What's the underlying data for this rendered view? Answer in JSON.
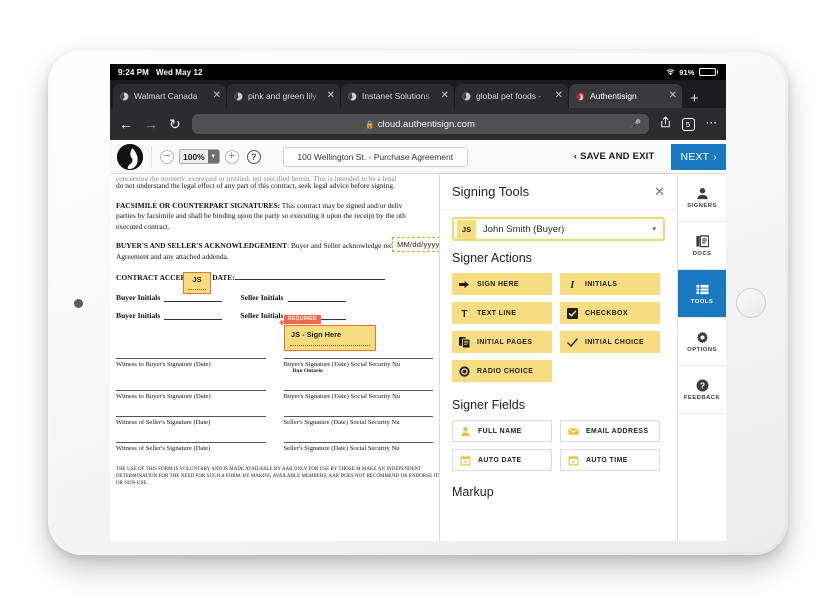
{
  "status_bar": {
    "time": "9:24 PM",
    "date": "Wed May 12",
    "battery_percent": "91%",
    "wifi_icon": "wifi-icon",
    "battery_icon": "battery-icon"
  },
  "browser": {
    "tabs": [
      {
        "title": "Walmart Canada",
        "favicon": "globe-icon",
        "active": false
      },
      {
        "title": "pink and green lily",
        "favicon": "globe-icon",
        "active": false
      },
      {
        "title": "Instanet Solutions",
        "favicon": "globe-icon",
        "active": false
      },
      {
        "title": "global pet foods -",
        "favicon": "globe-icon",
        "active": false
      },
      {
        "title": "Authentisign",
        "favicon": "authentisign-favicon",
        "active": true
      }
    ],
    "new_tab_label": "+",
    "close_label": "✕",
    "back_icon": "back-arrow-icon",
    "forward_icon": "forward-arrow-icon",
    "reload_icon": "reload-icon",
    "url": "cloud.authentisign.com",
    "lock_icon": "lock-icon",
    "mic_icon": "microphone-icon",
    "share_icon": "share-icon",
    "tab_count": "5",
    "more_icon": "more-icon"
  },
  "app_toolbar": {
    "logo": "authentisign-logo",
    "zoom_out_label": "−",
    "zoom_in_label": "+",
    "zoom_value": "100%",
    "help_label": "?",
    "document_title": "100 Wellington St. - Purchase Agreement",
    "save_and_exit_label": "SAVE AND EXIT",
    "save_and_exit_chevron": "‹",
    "next_label": "NEXT",
    "next_chevron": "›",
    "next_color": "#1878c0"
  },
  "document": {
    "cut_line": "concerning the property, expressed or implied, not specified herein. This is intended to be a legal",
    "paragraphs": [
      {
        "heading": "",
        "text": "do not understand the legal effect of any part of this contract, seek legal advice before signing."
      },
      {
        "heading": "FACSIMILE OR COUNTERPART SIGNATURES:",
        "text": " This contract may be signed and/or deliv",
        "line2": "parties by facsimile and shall be binding upon the party so executing it upon the receipt by the oth",
        "line3": "executed contract."
      },
      {
        "heading": "BUYER'S AND SELLER'S ACKNOWLEDGEMENT",
        "text": ": Buyer and Seller acknowledge receipt",
        "line2": "Agreement and any attached addenda."
      }
    ],
    "contract_acceptance_label": "CONTRACT ACCEPTANCE DATE:",
    "initials_rows": [
      {
        "buyer": "Buyer Initials",
        "seller": "Seller Initials"
      },
      {
        "buyer": "Buyer Initials",
        "seller": "Seller Initials"
      }
    ],
    "signature_rows": [
      {
        "left": "Witness to Buyer's Signature (Date)",
        "right": "Buyer's Signature (Date) Social Security Nu",
        "sub": "Dan Ontario"
      },
      {
        "left": "Witness to Buyer's Signature (Date)",
        "right": "Buyer's Signature (Date) Social Security Nu",
        "sub": ""
      },
      {
        "left": "Witness of Seller's Signature (Date)",
        "right": "Seller's Signature (Date) Social Security Nu",
        "sub": ""
      },
      {
        "left": "Witness of Seller's Signature (Date)",
        "right": "Seller's Signature (Date) Social Security Nu",
        "sub": ""
      }
    ],
    "fineprint": "THE USE OF THIS FORM IS VOLUNTARY AND IS MADE AVAILABLE BY AAR ONLY FOR USE BY THOSE M MAKE AN INDEPENDENT DETERMINATION FOR THE NEED FOR SUCH A FORM. BY MAKING AVAILABLE MEMBERS, AAR DOES NOT RECOMMEND OR ENDORSE ITS USE OR NON-USE.",
    "tags": {
      "date_placeholder": "MM/dd/yyyy",
      "initial_tag": "JS",
      "required_label": "REQUIRED",
      "sign_here_tag": "JS - Sign Here"
    }
  },
  "panel": {
    "title": "Signing Tools",
    "close_icon": "close-icon",
    "signer": {
      "initials": "JS",
      "name": "John Smith (Buyer)",
      "caret": "▾"
    },
    "signer_actions_title": "Signer Actions",
    "signer_actions": [
      {
        "label": "SIGN HERE",
        "icon": "arrow-right-icon",
        "style": "yellow"
      },
      {
        "label": "INITIALS",
        "icon": "italic-i-icon",
        "style": "yellow"
      },
      {
        "label": "TEXT LINE",
        "icon": "text-t-icon",
        "style": "yellow"
      },
      {
        "label": "CHECKBOX",
        "icon": "checkbox-icon",
        "style": "yellow"
      },
      {
        "label": "INITIAL PAGES",
        "icon": "copy-pages-icon",
        "style": "yellow"
      },
      {
        "label": "INITIAL CHOICE",
        "icon": "check-icon",
        "style": "yellow"
      },
      {
        "label": "RADIO CHOICE",
        "icon": "radio-button-icon",
        "style": "yellow"
      }
    ],
    "signer_fields_title": "Signer Fields",
    "signer_fields": [
      {
        "label": "FULL NAME",
        "icon": "person-icon",
        "style": "white"
      },
      {
        "label": "EMAIL ADDRESS",
        "icon": "envelope-icon",
        "style": "white"
      },
      {
        "label": "AUTO DATE",
        "icon": "calendar-icon",
        "style": "white"
      },
      {
        "label": "AUTO TIME",
        "icon": "calendar-icon",
        "style": "white"
      }
    ],
    "markup_title": "Markup"
  },
  "rail": {
    "items": [
      {
        "label": "SIGNERS",
        "icon": "person-icon",
        "active": false
      },
      {
        "label": "DOCS",
        "icon": "documents-icon",
        "active": false
      },
      {
        "label": "TOOLS",
        "icon": "tools-list-icon",
        "active": true
      },
      {
        "label": "OPTIONS",
        "icon": "gear-icon",
        "active": false
      },
      {
        "label": "FEEDBACK",
        "icon": "question-circle-icon",
        "active": false
      }
    ],
    "active_color": "#1878c0"
  }
}
